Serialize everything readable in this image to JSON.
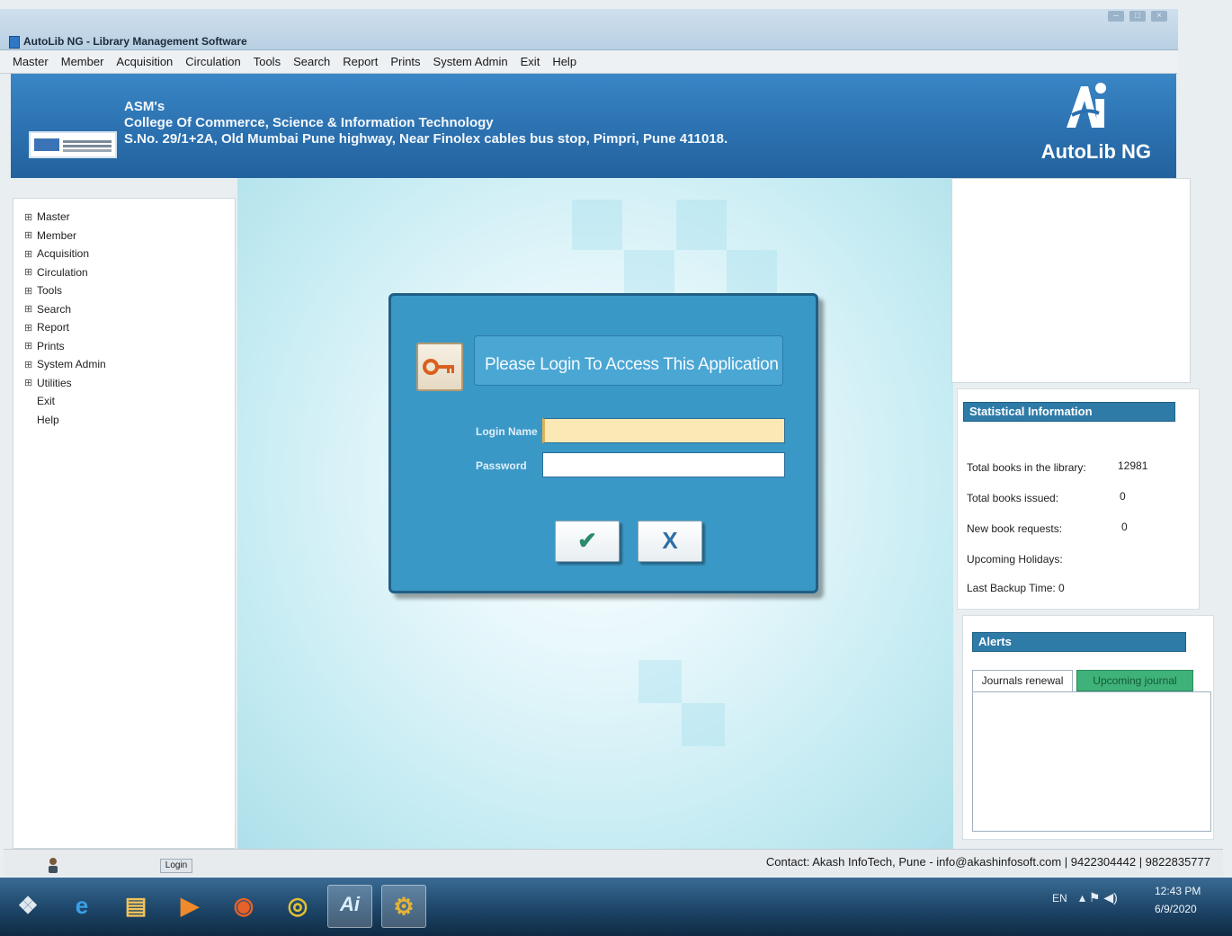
{
  "window": {
    "title": "AutoLib NG - Library Management Software",
    "controls": [
      "–",
      "□",
      "×"
    ]
  },
  "menubar": [
    "Master",
    "Member",
    "Acquisition",
    "Circulation",
    "Tools",
    "Search",
    "Report",
    "Prints",
    "System Admin",
    "Exit",
    "Help"
  ],
  "header": {
    "org_line1": "ASM's",
    "org_line2": "College Of Commerce, Science & Information Technology",
    "org_line3": "S.No. 29/1+2A, Old Mumbai Pune highway, Near Finolex cables bus stop, Pimpri, Pune 411018.",
    "brand": "AutoLib NG"
  },
  "sidebar": {
    "items": [
      {
        "label": "Master",
        "expander": "⊞"
      },
      {
        "label": "Member",
        "expander": "⊞"
      },
      {
        "label": "Acquisition",
        "expander": "⊞"
      },
      {
        "label": "Circulation",
        "expander": "⊞"
      },
      {
        "label": "Tools",
        "expander": "⊞"
      },
      {
        "label": "Search",
        "expander": "⊞"
      },
      {
        "label": "Report",
        "expander": "⊞"
      },
      {
        "label": "Prints",
        "expander": "⊞"
      },
      {
        "label": "System Admin",
        "expander": "⊞"
      },
      {
        "label": "Utilities",
        "expander": "⊞"
      },
      {
        "label": "Exit",
        "expander": ""
      },
      {
        "label": "Help",
        "expander": ""
      }
    ]
  },
  "login": {
    "heading": "Please Login To Access This Application",
    "login_name_label": "Login Name",
    "password_label": "Password",
    "login_name_value": "",
    "password_value": "",
    "ok_glyph": "✔",
    "cancel_glyph": "X"
  },
  "stats": {
    "heading": "Statistical Information",
    "rows": [
      {
        "label": "Total books in the library:",
        "value": "12981"
      },
      {
        "label": "Total books issued:",
        "value": "0"
      },
      {
        "label": "New book requests:",
        "value": "0"
      },
      {
        "label": "Upcoming Holidays:",
        "value": ""
      },
      {
        "label": "Last Backup Time: 0",
        "value": ""
      }
    ]
  },
  "alerts": {
    "heading": "Alerts",
    "tabs": [
      "Journals renewal",
      "Upcoming journal"
    ]
  },
  "statusbar": {
    "login_label": "Login",
    "contact": "Contact: Akash InfoTech, Pune - info@akashinfosoft.com | 9422304442 | 9822835777"
  },
  "taskbar": {
    "apps": [
      {
        "name": "start",
        "glyph": "❖",
        "color": "#dfe8ef"
      },
      {
        "name": "internet-explorer",
        "glyph": "e",
        "color": "#3aa0e8"
      },
      {
        "name": "file-explorer",
        "glyph": "▤",
        "color": "#f2c35a"
      },
      {
        "name": "media-player",
        "glyph": "▶",
        "color": "#f08a2a"
      },
      {
        "name": "firefox",
        "glyph": "◉",
        "color": "#e5622a"
      },
      {
        "name": "chrome",
        "glyph": "◎",
        "color": "#e6c233"
      },
      {
        "name": "autolib",
        "glyph": "Ai",
        "color": "#dceefb"
      },
      {
        "name": "app-key",
        "glyph": "⚙",
        "color": "#e2b33c"
      }
    ],
    "tray_lang": "EN",
    "tray_icons": "▴  ⚑  ◀)",
    "time": "12:43 PM",
    "date": "6/9/2020"
  },
  "colors": {
    "banner": "#2a6fae",
    "dialog": "#3a98c7",
    "ok_check": "#2a8a6a",
    "cancel_x": "#2f6fa8",
    "panel_head": "#2f7ba8",
    "active_tab": "#3fb27a"
  }
}
